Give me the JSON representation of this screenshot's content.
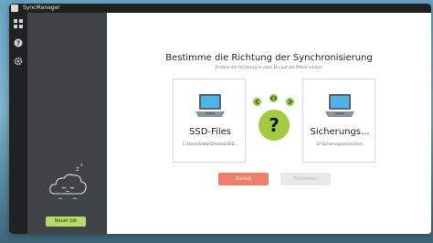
{
  "window": {
    "title": "SyncManager",
    "app_icon": "syncmanager-app-icon"
  },
  "iconbar": {
    "icons": [
      "dashboard-icon",
      "help-icon",
      "settings-icon"
    ]
  },
  "sidebar": {
    "new_job_label": "Neuer Job",
    "illustration": "sleeping-cloud-icon"
  },
  "main": {
    "heading": "Bestimme die Richtung der Synchronisierung",
    "subheading": "Ändere die Richtung in dem Du auf die Pfeile klickst.",
    "source": {
      "name": "SSD-Files",
      "path": "C:\\Users\\teddy\\Desktop\\SSD...",
      "icon": "laptop-icon"
    },
    "target": {
      "name": "Sicherungs...",
      "path": "D:\\Sicherungsverzeichnis",
      "icon": "laptop-icon"
    },
    "direction_unknown_symbol": "?",
    "buttons": {
      "back": "Zurück",
      "next": "Fortsetzen"
    }
  },
  "colors": {
    "accent_green": "#a3cc42",
    "back_button": "#ee7f6b",
    "new_job_button": "#b6d96a",
    "sidebar": "#3f4247"
  }
}
